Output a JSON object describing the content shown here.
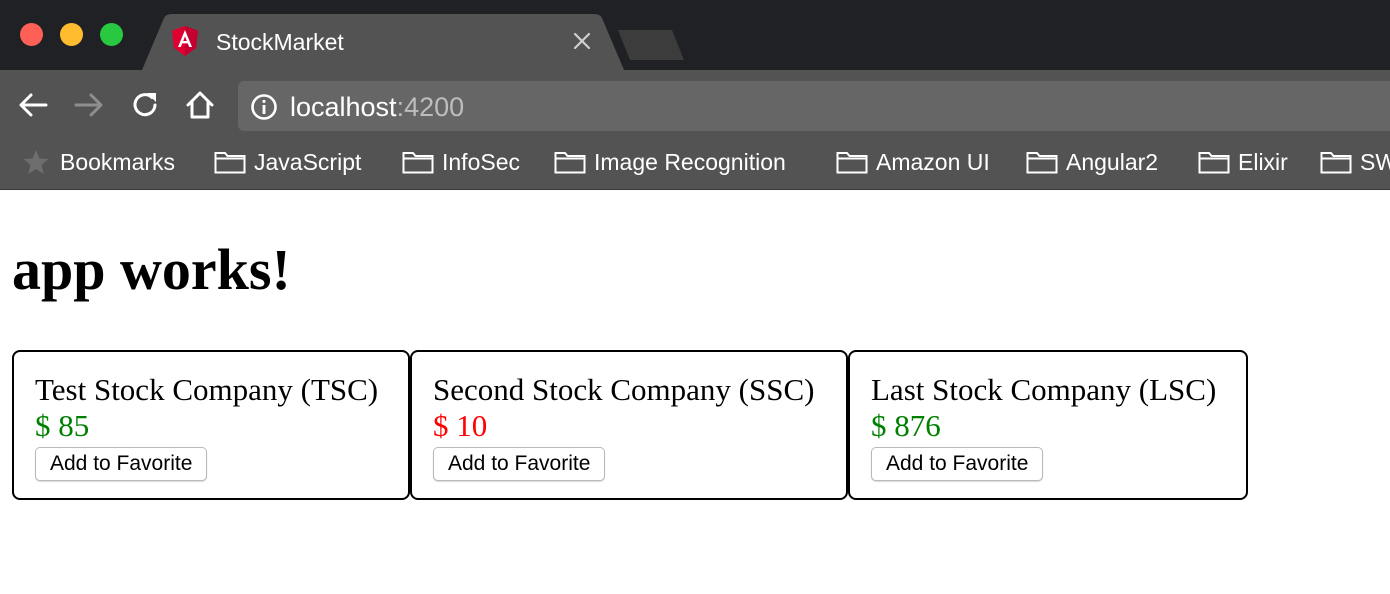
{
  "browser": {
    "tab": {
      "title": "StockMarket"
    },
    "address": {
      "host": "localhost",
      "port": ":4200"
    },
    "bookmarks_bar": [
      {
        "label": "Bookmarks"
      },
      {
        "label": "JavaScript"
      },
      {
        "label": "InfoSec"
      },
      {
        "label": "Image Recognition"
      },
      {
        "label": "Amazon UI"
      },
      {
        "label": "Angular2"
      },
      {
        "label": "Elixir"
      },
      {
        "label": "SW"
      }
    ]
  },
  "page": {
    "heading": "app works!",
    "stocks": [
      {
        "name": "Test Stock Company (TSC)",
        "price": "$ 85",
        "price_color": "#008000",
        "button_label": "Add to Favorite"
      },
      {
        "name": "Second Stock Company (SSC)",
        "price": "$ 10",
        "price_color": "#ff0000",
        "button_label": "Add to Favorite"
      },
      {
        "name": "Last Stock Company (LSC)",
        "price": "$ 876",
        "price_color": "#008000",
        "button_label": "Add to Favorite"
      }
    ]
  },
  "colors": {
    "price_up": "#008000",
    "price_down": "#ff0000",
    "chrome_dark": "#202124",
    "chrome_toolbar": "#535353"
  }
}
